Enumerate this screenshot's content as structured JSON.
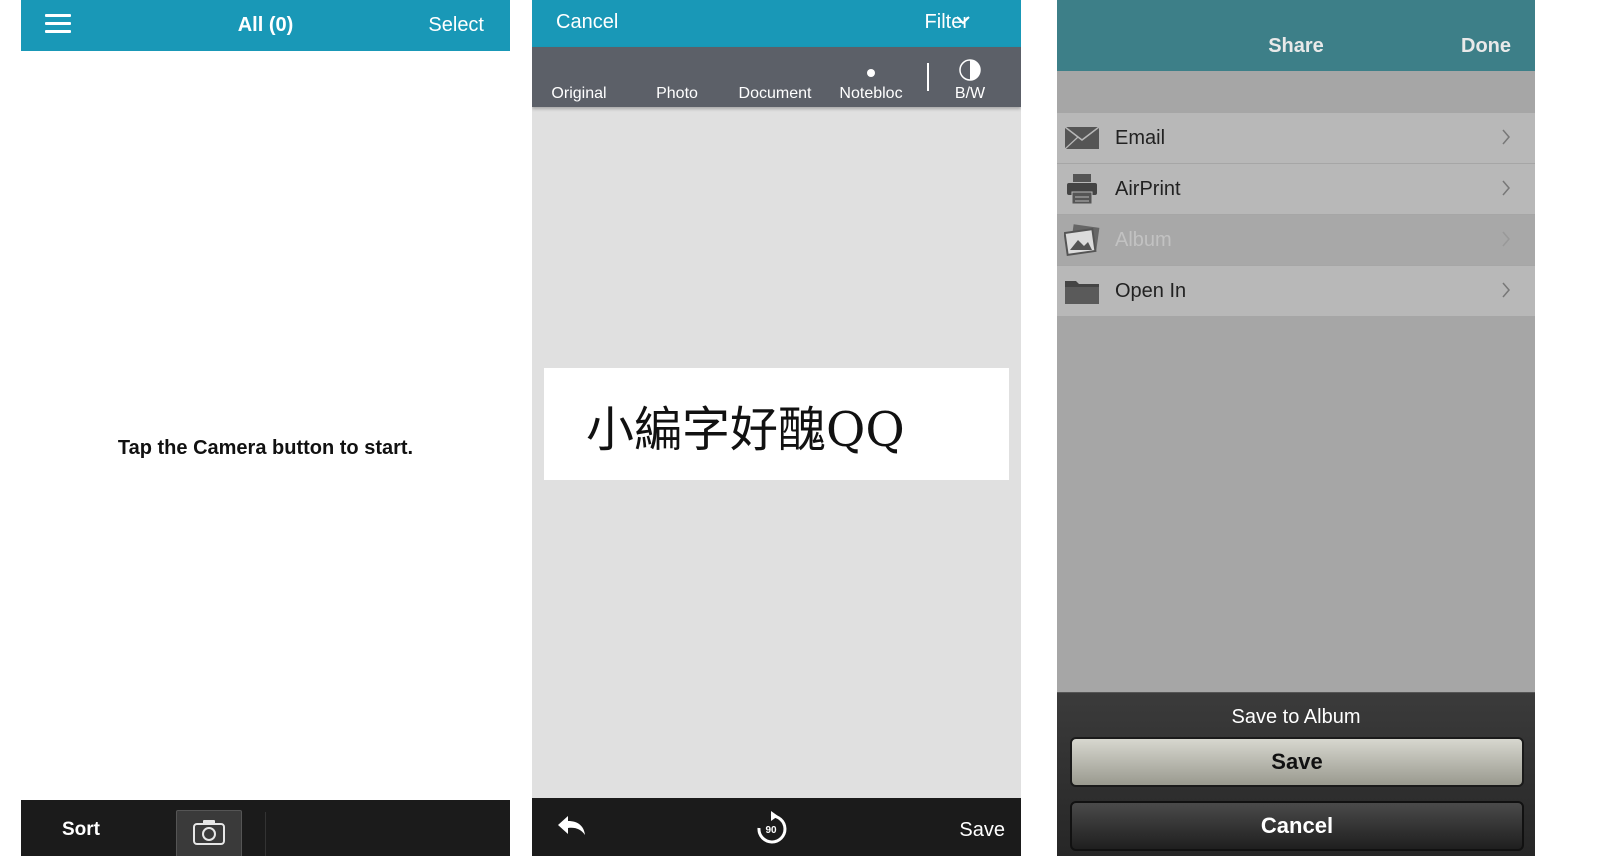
{
  "screen1": {
    "header": {
      "title": "All (0)",
      "select_label": "Select"
    },
    "empty_message": "Tap the Camera button to start.",
    "footer": {
      "sort_label": "Sort"
    },
    "icons": {
      "menu": "hamburger-menu-icon",
      "camera": "camera-icon"
    }
  },
  "screen2": {
    "header": {
      "cancel_label": "Cancel",
      "filter_label": "Filter"
    },
    "filters": [
      "Original",
      "Photo",
      "Document",
      "Notebloc",
      "B/W"
    ],
    "selected_filter": "Notebloc",
    "document_text": "小編字好醜QQ",
    "footer": {
      "save_label": "Save",
      "rotate_label": "90"
    },
    "icons": {
      "undo": "undo-icon",
      "rotate": "rotate-90-icon",
      "bw": "contrast-icon"
    }
  },
  "screen3": {
    "header": {
      "title": "Share",
      "done_label": "Done"
    },
    "share_options": [
      {
        "label": "Email",
        "icon": "envelope-icon",
        "enabled": true
      },
      {
        "label": "AirPrint",
        "icon": "printer-icon",
        "enabled": true
      },
      {
        "label": "Album",
        "icon": "photo-album-icon",
        "enabled": false
      },
      {
        "label": "Open In",
        "icon": "folder-icon",
        "enabled": true
      }
    ],
    "action_sheet": {
      "title": "Save to Album",
      "save_label": "Save",
      "cancel_label": "Cancel"
    }
  },
  "colors": {
    "accent_teal": "#1998b7",
    "share_header": "#3d7f88",
    "toolbar_dark": "#1b1b1b",
    "filter_bar": "#5c6068"
  }
}
